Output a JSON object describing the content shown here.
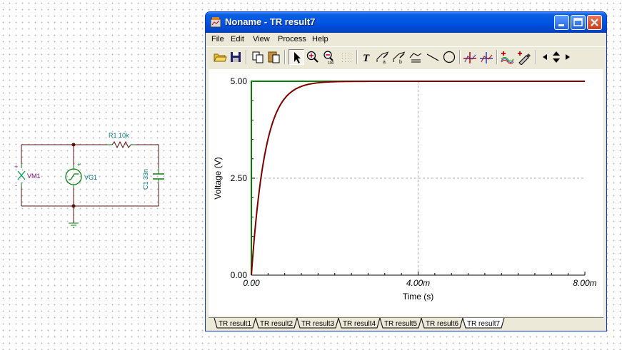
{
  "schematic": {
    "components": {
      "vm1": "VM1",
      "vg1": "VG1",
      "r1": "R1 10k",
      "c1": "C1 33n",
      "plus": "+",
      "minus": "-"
    }
  },
  "window": {
    "title": "Noname - TR result7",
    "menu": {
      "file": "File",
      "edit": "Edit",
      "view": "View",
      "process": "Process",
      "help": "Help"
    },
    "toolbar_icons": [
      "open-icon",
      "save-icon",
      "copy-icon",
      "paste-icon",
      "pointer-icon",
      "zoom-in-icon",
      "zoom-100-icon",
      "grid-icon",
      "text-icon",
      "cursor-a-icon",
      "cursor-b-icon",
      "cursor-list-icon",
      "line-icon",
      "circle-icon",
      "cursor-a-mark-icon",
      "cursor-b-mark-icon",
      "add-curve-icon",
      "pick-curve-icon",
      "arrow-left-icon",
      "arrow-up-down-icon",
      "arrow-right-icon"
    ],
    "tabs": [
      "TR result1",
      "TR result2",
      "TR result3",
      "TR result4",
      "TR result5",
      "TR result6",
      "TR result7"
    ],
    "active_tab": "TR result7"
  },
  "chart_data": {
    "type": "line",
    "xlabel": "Time (s)",
    "ylabel": "Voltage (V)",
    "xlim": [
      0,
      0.008
    ],
    "ylim": [
      0,
      5
    ],
    "x_ticks": [
      "0.00",
      "4.00m",
      "8.00m"
    ],
    "y_ticks": [
      "0.00",
      "2.50",
      "5.00"
    ],
    "grid": true,
    "series": [
      {
        "color": "#008000",
        "kind": "step",
        "step_value": 5,
        "x": [
          0,
          0.008
        ],
        "values": [
          5,
          5
        ]
      },
      {
        "color": "#800000",
        "kind": "rc_charge",
        "amplitude": 5,
        "tau": 0.00033,
        "x": [
          0,
          0.0001,
          0.0002,
          0.0003,
          0.0005,
          0.0007,
          0.001,
          0.0015,
          0.002,
          0.004,
          0.008
        ],
        "values": [
          0,
          1.3,
          2.27,
          2.99,
          3.9,
          4.39,
          4.76,
          4.95,
          4.99,
          5.0,
          5.0
        ]
      }
    ]
  }
}
